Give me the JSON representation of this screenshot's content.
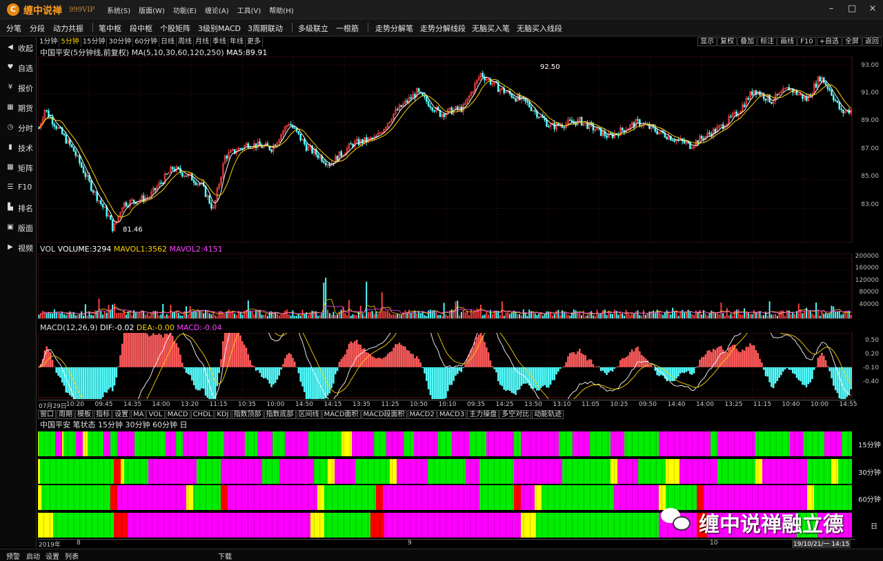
{
  "app": {
    "title": "缠中说禅",
    "subtitle": "999VIP",
    "logo_letter": "C",
    "menu": [
      "系统(S)",
      "版面(W)",
      "功能(E)",
      "缠论(A)",
      "工具(V)",
      "帮助(H)"
    ]
  },
  "toolbar": [
    "分笔",
    "分段",
    "动力共振",
    "笔中枢",
    "段中枢",
    "个股矩阵",
    "3级别MACD",
    "3周期联动",
    "多级联立",
    "一根筋",
    "走势分解笔",
    "走势分解线段",
    "无脑买入笔",
    "无脑买入线段"
  ],
  "sidebar": [
    {
      "icon": "◀",
      "label": "收起"
    },
    {
      "icon": "♥",
      "label": "自选"
    },
    {
      "icon": "¥",
      "label": "报价"
    },
    {
      "icon": "▦",
      "label": "期货"
    },
    {
      "icon": "◷",
      "label": "分时"
    },
    {
      "icon": "▮",
      "label": "技术"
    },
    {
      "icon": "▩",
      "label": "矩阵"
    },
    {
      "icon": "☰",
      "label": "F10"
    },
    {
      "icon": "▙",
      "label": "排名"
    },
    {
      "icon": "▣",
      "label": "版面"
    },
    {
      "icon": "▶",
      "label": "视频"
    }
  ],
  "periods": [
    "1分钟",
    "5分钟",
    "15分钟",
    "30分钟",
    "60分钟",
    "日线",
    "周线",
    "月线",
    "季线",
    "年线",
    "更多"
  ],
  "active_period": "5分钟",
  "right_buttons": [
    "显示",
    "复权",
    "叠加",
    "标注",
    "画线",
    "F10",
    "+自选",
    "全屏",
    "返回"
  ],
  "price_panel": {
    "header_prefix": "中国平安(5分钟线,前复权) MA(5,10,30,60,120,250)",
    "ma5_text": "MA5:89.91",
    "high_label": "92.50",
    "low_label": "81.46",
    "y_ticks": [
      "93.00",
      "91.00",
      "89.00",
      "87.00",
      "85.00",
      "83.00"
    ]
  },
  "vol_panel": {
    "label": "VOL",
    "volume": "VOLUME:3294",
    "mavol1": "MAVOL1:3562",
    "mavol2": "MAVOL2:4151",
    "y_ticks": [
      "200000",
      "160000",
      "120000",
      "80000",
      "40000"
    ]
  },
  "macd_panel": {
    "label": "MACD(12,26,9)",
    "dif": "DIF:-0.02",
    "dea": "DEA:-0.00",
    "macd": "MACD:-0.04",
    "y_ticks": [
      "0.50",
      "0.20",
      "-0.10",
      "-0.40"
    ]
  },
  "time_axis": [
    "07月29日",
    "10:20",
    "09:45",
    "14:35",
    "14:00",
    "13:20",
    "11:15",
    "10:35",
    "10:00",
    "14:50",
    "14:15",
    "13:35",
    "11:25",
    "10:50",
    "10:10",
    "09:35",
    "14:25",
    "13:50",
    "13:10",
    "11:05",
    "10:25",
    "09:50",
    "14:40",
    "14:00",
    "13:25",
    "11:15",
    "10:40",
    "10:00",
    "14:55"
  ],
  "indicator_tabs": [
    "窗口",
    "周期",
    "模板",
    "指标",
    "设置",
    "MA",
    "VOL",
    "MACD",
    "CHDL",
    "KDJ",
    "指数顶部",
    "指数底部",
    "区间线",
    "MACD面积",
    "MACD段面积",
    "MACD2",
    "MACD3",
    "主力操盘",
    "多空对比",
    "动能轨迹"
  ],
  "state_panel": {
    "header": "中国平安 笔状态 15分钟 30分钟 60分钟 日",
    "bands": [
      "15分钟",
      "30分钟",
      "60分钟",
      "日"
    ],
    "date_labels": [
      "2019年",
      "8",
      "9",
      "10"
    ],
    "datetime": "19/10/21/一 14:15"
  },
  "watermark": "缠中说禅融立德",
  "status": [
    "预警",
    "启动",
    "设置",
    "列表",
    "下载"
  ],
  "colors": {
    "up": "#ff4040",
    "down": "#54ffff",
    "ma_yellow": "#ffd400",
    "ma_magenta": "#ff40ff",
    "state_green": "#00ee00",
    "state_magenta": "#ff00ff",
    "state_yellow": "#ffff00",
    "state_red": "#ff0000"
  }
}
